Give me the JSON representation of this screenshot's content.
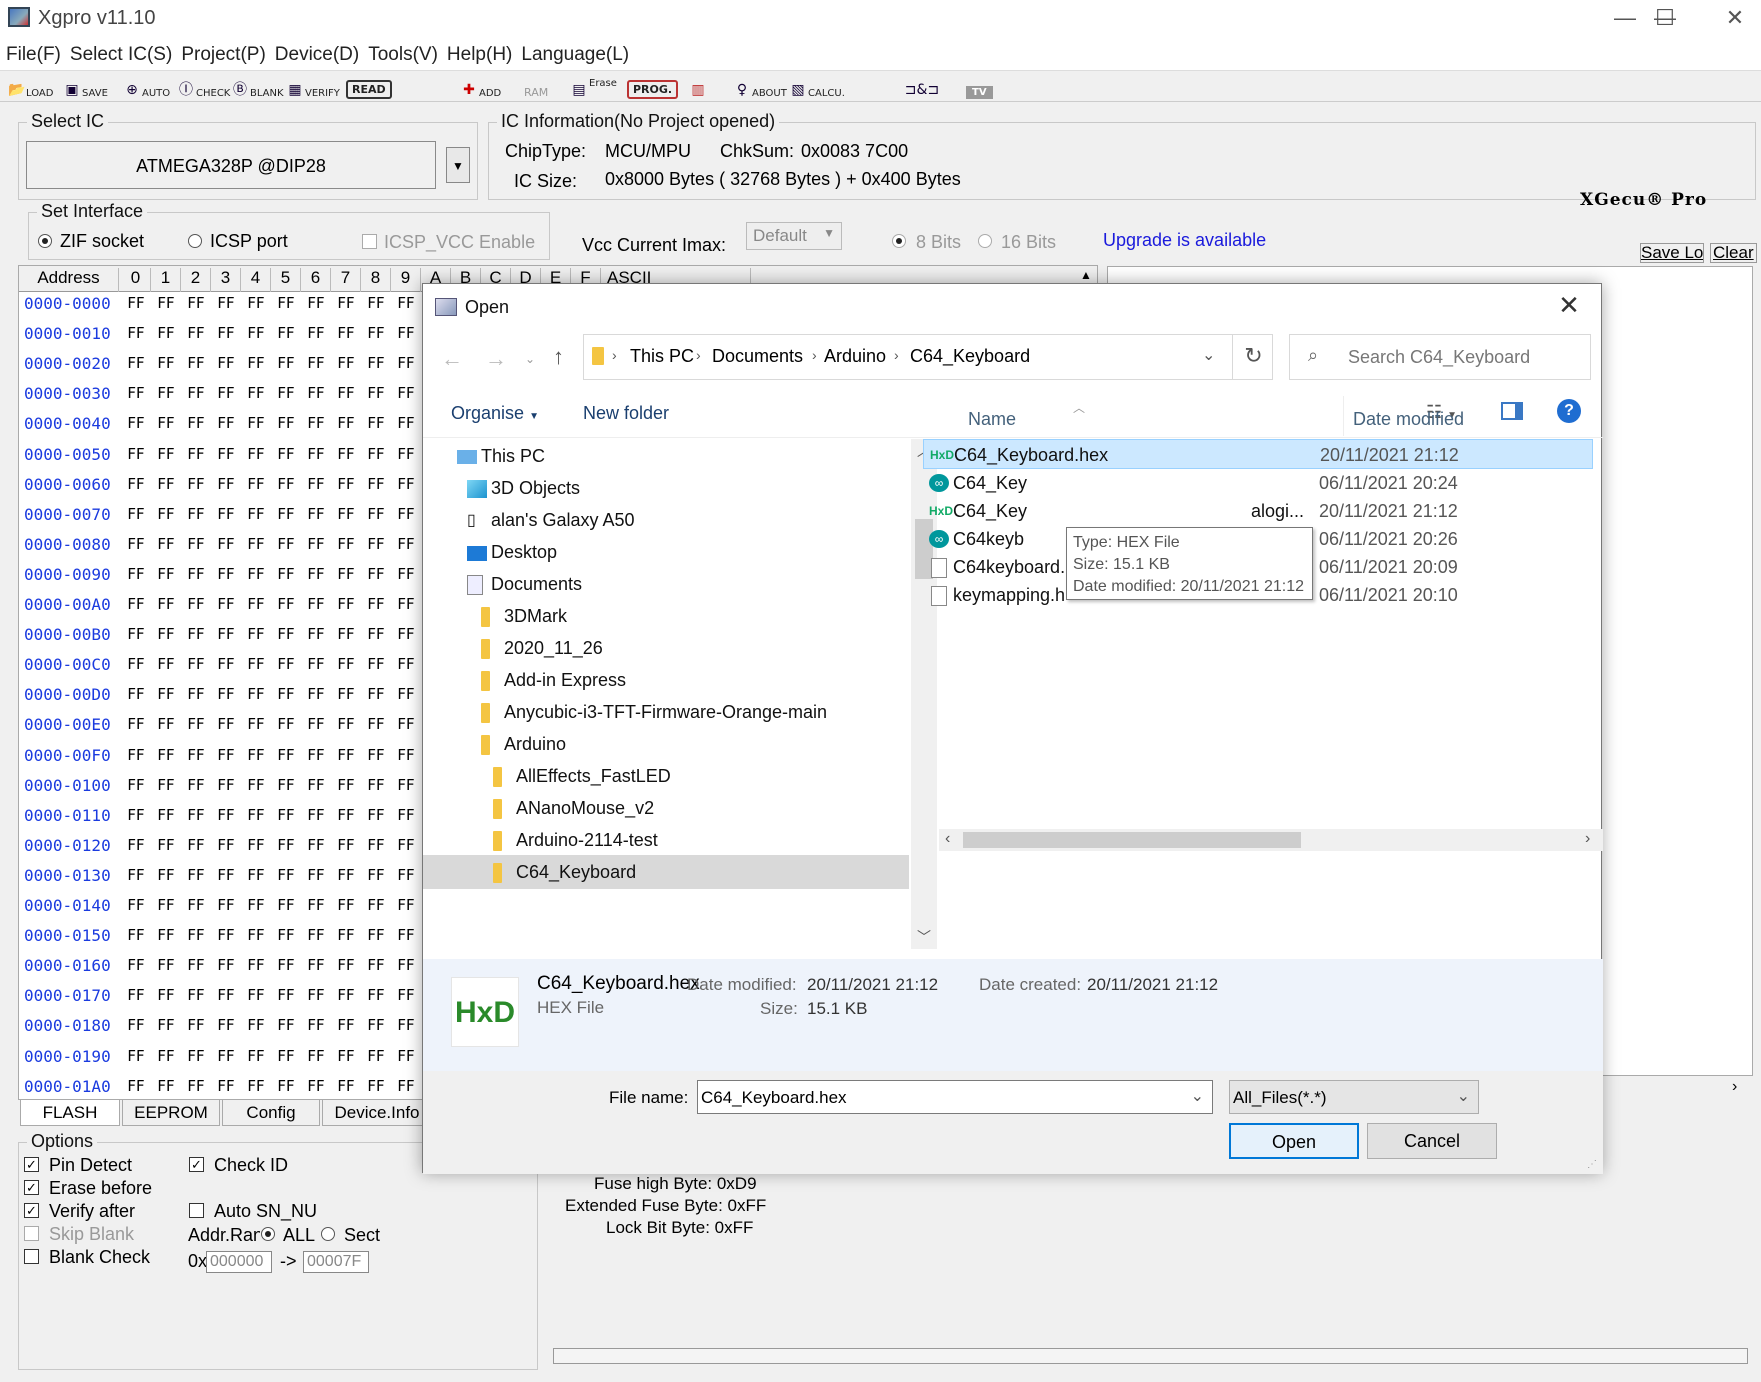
{
  "window": {
    "title": "Xgpro v11.10"
  },
  "menu": [
    "File(F)",
    "Select IC(S)",
    "Project(P)",
    "Device(D)",
    "Tools(V)",
    "Help(H)",
    "Language(L)"
  ],
  "toolbar": {
    "load": "LOAD",
    "save": "SAVE",
    "auto": "AUTO",
    "check": "CHECK",
    "blank": "BLANK",
    "verify": "VERIFY",
    "read": "READ",
    "add": "ADD",
    "ram": "RAM",
    "erase": "Erase",
    "prog": "PROG.",
    "about": "ABOUT",
    "calcu": "CALCU.",
    "tv": "TV"
  },
  "select_ic": {
    "title": "Select IC",
    "value": "ATMEGA328P @DIP28"
  },
  "ic_info": {
    "title": "IC Information(No Project opened)",
    "chiptype_label": "ChipType:",
    "chiptype": "MCU/MPU",
    "chksum_label": "ChkSum:",
    "chksum": "0x0083 7C00",
    "size_label": "IC Size:",
    "size": "0x8000 Bytes ( 32768 Bytes ) + 0x400 Bytes",
    "brand": "XGecu® Pro"
  },
  "interface": {
    "title": "Set Interface",
    "zif": "ZIF socket",
    "icsp": "ICSP port",
    "icsp_vcc": "ICSP_VCC Enable",
    "vcc_label": "Vcc Current Imax:",
    "vcc_value": "Default",
    "bits8": "8 Bits",
    "bits16": "16 Bits",
    "upgrade": "Upgrade is available",
    "save_log": "Save Log",
    "clear": "Clear"
  },
  "hex": {
    "header": [
      "Address",
      "0",
      "1",
      "2",
      "3",
      "4",
      "5",
      "6",
      "7",
      "8",
      "9",
      "A",
      "B",
      "C",
      "D",
      "E",
      "F",
      "ASCII"
    ],
    "addresses": [
      "0000-0000",
      "0000-0010",
      "0000-0020",
      "0000-0030",
      "0000-0040",
      "0000-0050",
      "0000-0060",
      "0000-0070",
      "0000-0080",
      "0000-0090",
      "0000-00A0",
      "0000-00B0",
      "0000-00C0",
      "0000-00D0",
      "0000-00E0",
      "0000-00F0",
      "0000-0100",
      "0000-0110",
      "0000-0120",
      "0000-0130",
      "0000-0140",
      "0000-0150",
      "0000-0160",
      "0000-0170",
      "0000-0180",
      "0000-0190",
      "0000-01A0"
    ],
    "byte": "FF"
  },
  "tabs": [
    "FLASH",
    "EEPROM",
    "Config",
    "Device.Info"
  ],
  "options": {
    "title": "Options",
    "pin_detect": "Pin Detect",
    "erase_before": "Erase before",
    "verify_after": "Verify after",
    "skip_blank": "Skip Blank",
    "blank_check": "Blank Check",
    "check_id": "Check ID",
    "auto_sn": "Auto SN_NUI",
    "addr_range": "Addr.Ran",
    "all": "ALL",
    "sect": "Sect",
    "hex_prefix": "0x",
    "from": "000000",
    "arrow": "->",
    "to": "00007F"
  },
  "fuses": {
    "high": "Fuse high Byte: 0xD9",
    "ext": "Extended Fuse Byte: 0xFF",
    "lock": "Lock Bit Byte: 0xFF"
  },
  "dialog": {
    "title": "Open",
    "path": [
      "This PC",
      "Documents",
      "Arduino",
      "C64_Keyboard"
    ],
    "search_placeholder": "Search C64_Keyboard",
    "organise": "Organise",
    "new_folder": "New folder",
    "tree": [
      {
        "label": "This PC",
        "level": 0
      },
      {
        "label": "3D Objects",
        "level": 1
      },
      {
        "label": "alan's Galaxy A50",
        "level": 1
      },
      {
        "label": "Desktop",
        "level": 1
      },
      {
        "label": "Documents",
        "level": 1
      },
      {
        "label": "3DMark",
        "level": 2
      },
      {
        "label": "2020_11_26",
        "level": 2
      },
      {
        "label": "Add-in Express",
        "level": 2
      },
      {
        "label": "Anycubic-i3-TFT-Firmware-Orange-main",
        "level": 2
      },
      {
        "label": "Arduino",
        "level": 2
      },
      {
        "label": "AllEffects_FastLED",
        "level": 3
      },
      {
        "label": "ANanoMouse_v2",
        "level": 3
      },
      {
        "label": "Arduino-2114-test",
        "level": 3
      },
      {
        "label": "C64_Keyboard",
        "level": 3
      }
    ],
    "col_name": "Name",
    "col_date": "Date modified",
    "files": [
      {
        "name": "C64_Keyboard.hex",
        "date": "20/11/2021 21:12",
        "icon": "hxd"
      },
      {
        "name": "C64_Key",
        "date": "06/11/2021 20:24",
        "icon": "arduino"
      },
      {
        "name": "C64_Key",
        "extra": "alogi...",
        "date": "20/11/2021 21:12",
        "icon": "hxd"
      },
      {
        "name": "C64keyb",
        "date": "06/11/2021 20:26",
        "icon": "arduino"
      },
      {
        "name": "C64keyboard.h",
        "date": "06/11/2021 20:09",
        "icon": "file"
      },
      {
        "name": "keymapping.h",
        "date": "06/11/2021 20:10",
        "icon": "file"
      }
    ],
    "tooltip": {
      "type": "Type: HEX File",
      "size": "Size: 15.1 KB",
      "date": "Date modified: 20/11/2021 21:12"
    },
    "details": {
      "name": "C64_Keyboard.hex",
      "type": "HEX File",
      "date_modified_label": "Date modified:",
      "date_modified": "20/11/2021 21:12",
      "size_label": "Size:",
      "size": "15.1 KB",
      "date_created_label": "Date created:",
      "date_created": "20/11/2021 21:12"
    },
    "filename_label": "File name:",
    "filename": "C64_Keyboard.hex",
    "filter": "All_Files(*.*)",
    "open": "Open",
    "cancel": "Cancel"
  }
}
